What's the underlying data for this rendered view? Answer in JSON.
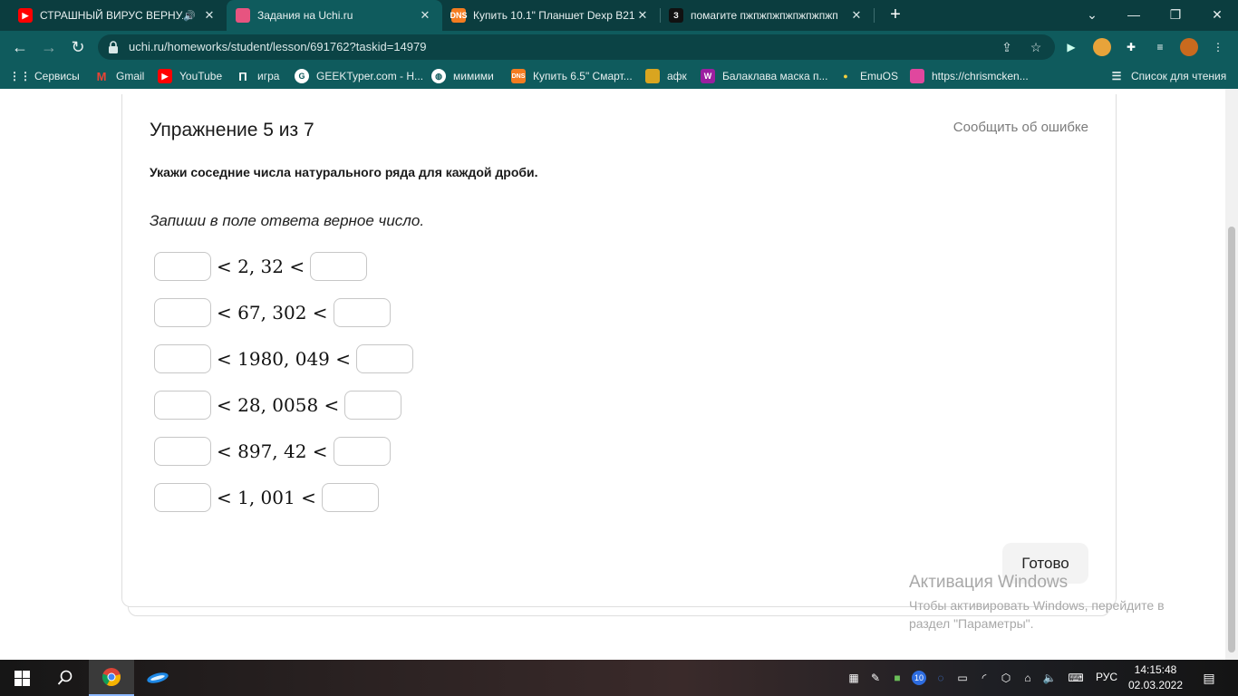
{
  "browser": {
    "tabs": [
      {
        "title": "СТРАШНЫЙ ВИРУС ВЕРНУЛ",
        "favicon": "youtube-icon",
        "color": "#ff0000",
        "audio": true
      },
      {
        "title": "Задания на Uchi.ru",
        "favicon": "uchi-icon",
        "color": "#e75480",
        "active": true
      },
      {
        "title": "Купить 10.1\" Планшет Dexp B21",
        "favicon": "dns-icon",
        "color": "#f47c20",
        "favicon_text": "DNS"
      },
      {
        "title": "помагите пжпжпжпжпжпжпжп",
        "favicon": "znanija-icon",
        "color": "#111111",
        "favicon_text": "З"
      }
    ],
    "url": "uchi.ru/homeworks/student/lesson/691762?taskid=14979",
    "bookmarks": [
      {
        "label": "Сервисы",
        "icon": "apps-grid-icon"
      },
      {
        "label": "Gmail",
        "icon": "gmail-icon"
      },
      {
        "label": "YouTube",
        "icon": "youtube-icon"
      },
      {
        "label": "игра",
        "icon": "pi-icon"
      },
      {
        "label": "GEEKTyper.com - Н...",
        "icon": "geektyper-icon"
      },
      {
        "label": "мимими",
        "icon": "globe-icon"
      },
      {
        "label": "Купить 6.5\" Смарт...",
        "icon": "dns-icon"
      },
      {
        "label": "афк",
        "icon": "afk-icon"
      },
      {
        "label": "Балаклава маска п...",
        "icon": "wildberries-icon"
      },
      {
        "label": "EmuOS",
        "icon": "emuos-icon"
      },
      {
        "label": "https://chrismcken...",
        "icon": "chris-icon"
      },
      {
        "label": "Список для чтения",
        "icon": "reading-list-icon"
      }
    ]
  },
  "exercise": {
    "title": "Упражнение 5 из 7",
    "report_link": "Сообщить об ошибке",
    "instruction": "Укажи соседние числа натурального ряда для каждой дроби.",
    "hint": "Запиши в поле ответа верное число.",
    "rows": [
      {
        "expr": "< 2, 32 <",
        "left": "",
        "right": ""
      },
      {
        "expr": "< 67, 302 <",
        "left": "",
        "right": ""
      },
      {
        "expr": "< 1980, 049 <",
        "left": "",
        "right": ""
      },
      {
        "expr": "< 28, 0058 <",
        "left": "",
        "right": ""
      },
      {
        "expr": "< 897, 42 <",
        "left": "",
        "right": ""
      },
      {
        "expr": "< 1, 001 <",
        "left": "",
        "right": ""
      }
    ],
    "done_label": "Готово"
  },
  "watermark": {
    "line1": "Активация Windows",
    "line2": "Чтобы активировать Windows, перейдите в",
    "line3": "раздел \"Параметры\"."
  },
  "taskbar": {
    "language": "РУС",
    "time": "14:15:48",
    "date": "02.03.2022",
    "notification_badge": "10"
  }
}
